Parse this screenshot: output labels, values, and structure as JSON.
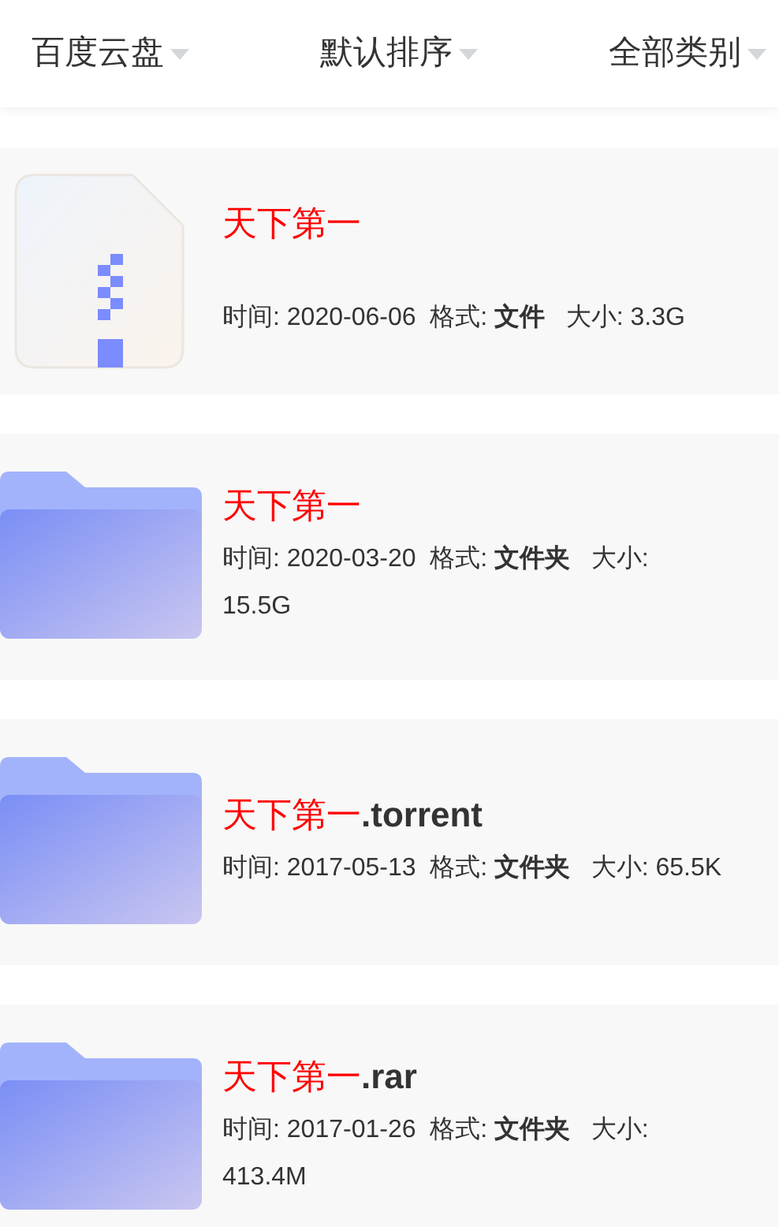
{
  "filters": [
    {
      "label": "百度云盘"
    },
    {
      "label": "默认排序"
    },
    {
      "label": "全部类别"
    }
  ],
  "files": [
    {
      "kind": "archive",
      "name": "天下第一",
      "meta": "时间: 2020-06-06  格式: **文件**   大小: 3.3G"
    },
    {
      "kind": "folder",
      "name": "天下第一",
      "meta": "时间: 2020-03-20  格式: **文件夹**   大小: 15.5G"
    },
    {
      "kind": "folder",
      "name": "天下第一",
      "extension": ".torrent",
      "meta": "时间: 2017-05-13  格式: **文件夹**   大小: 65.5K"
    },
    {
      "kind": "folder",
      "name": "天下第一",
      "extension": ".rar",
      "meta": "时间: 2017-01-26  格式: **文件夹**   大小: 413.4M"
    }
  ]
}
